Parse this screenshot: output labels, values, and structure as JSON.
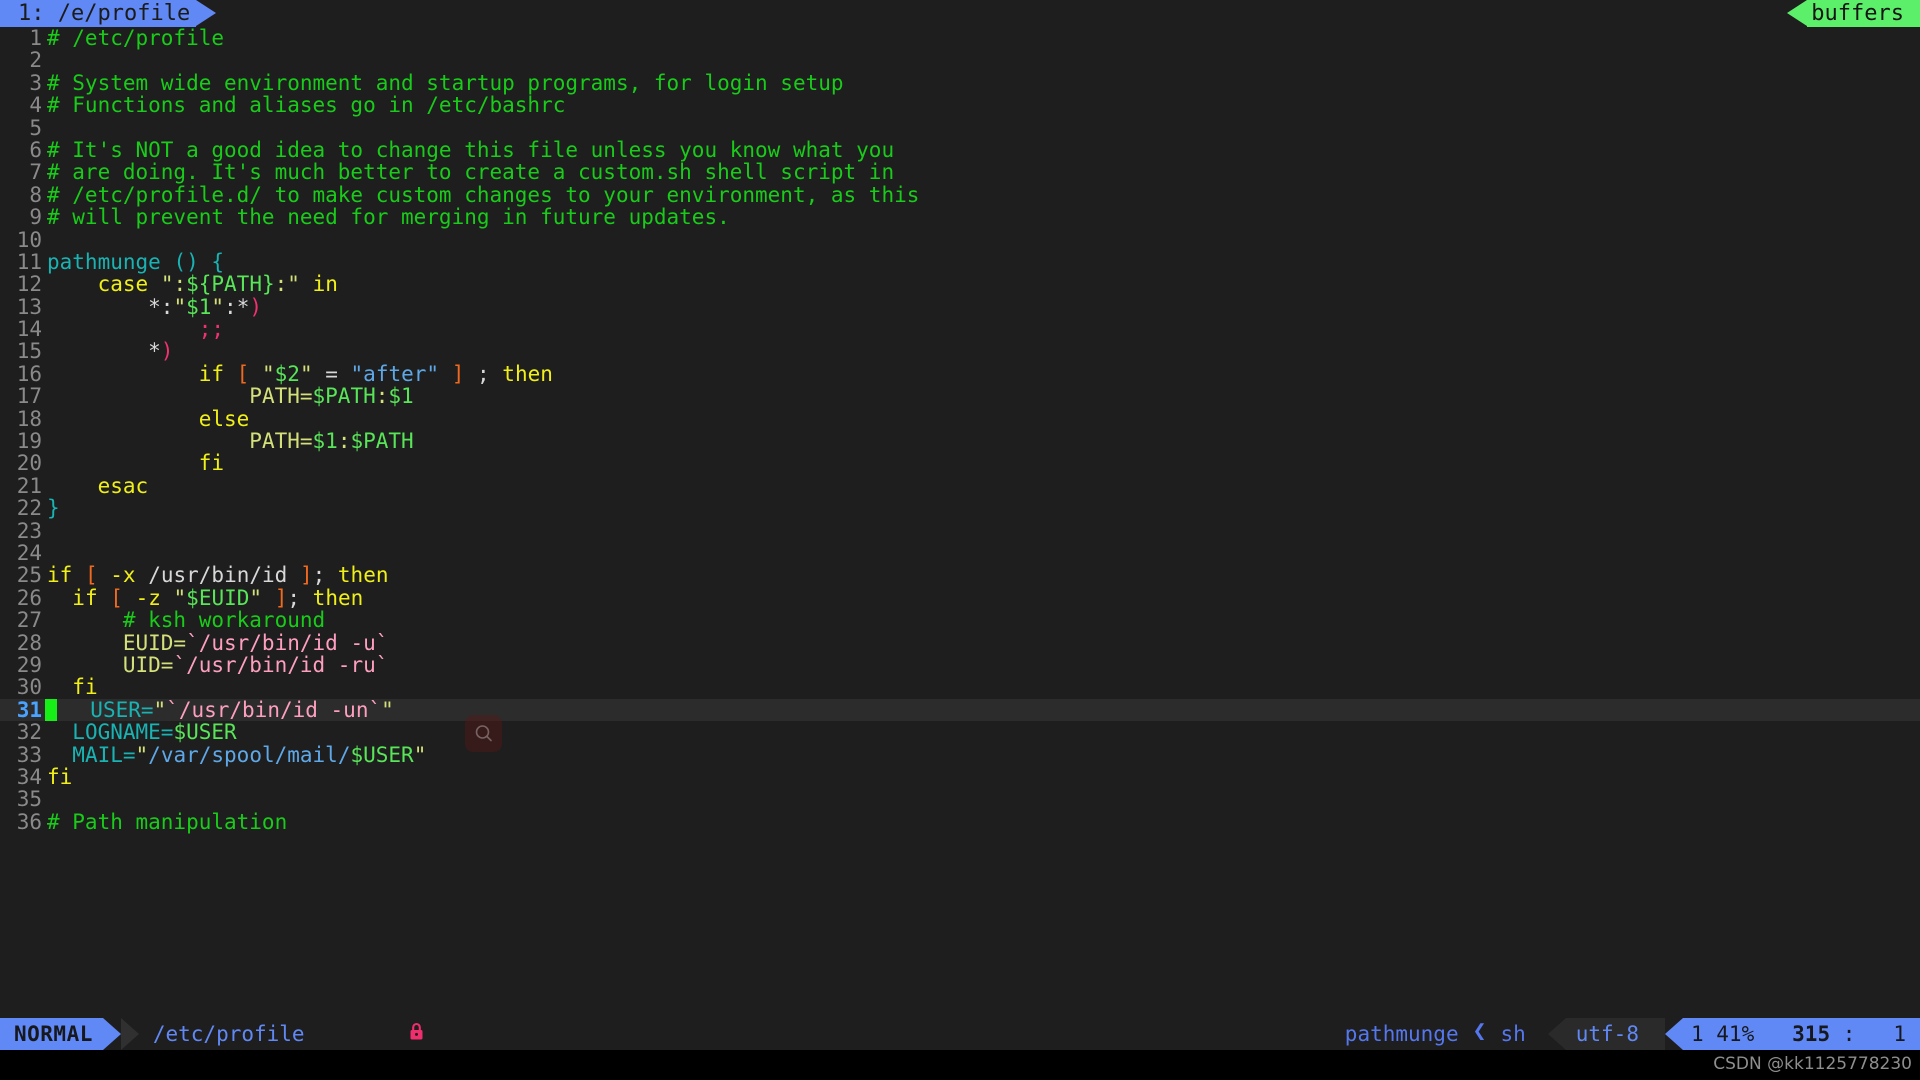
{
  "tabline": {
    "buffer_tab": "1: /e/profile",
    "buffers_label": "buffers",
    "tab_bg": "#6189f5",
    "buffers_bg": "#5cf06a"
  },
  "editor": {
    "filetype": "sh",
    "cursor_line": 31,
    "cursor_col": 1,
    "background": "#1e1e1e",
    "lines": [
      {
        "n": 1,
        "spans": [
          {
            "t": "# /etc/profile",
            "c": "c-comment"
          }
        ]
      },
      {
        "n": 2,
        "spans": []
      },
      {
        "n": 3,
        "spans": [
          {
            "t": "# System wide environment and startup programs, for login setup",
            "c": "c-comment"
          }
        ]
      },
      {
        "n": 4,
        "spans": [
          {
            "t": "# Functions and aliases go in /etc/bashrc",
            "c": "c-comment"
          }
        ]
      },
      {
        "n": 5,
        "spans": []
      },
      {
        "n": 6,
        "spans": [
          {
            "t": "# It's NOT a good idea to change this file unless you know what you",
            "c": "c-comment"
          }
        ]
      },
      {
        "n": 7,
        "spans": [
          {
            "t": "# are doing. It's much better to create a custom.sh shell script in",
            "c": "c-comment"
          }
        ]
      },
      {
        "n": 8,
        "spans": [
          {
            "t": "# /etc/profile.d/ to make custom changes to your environment, as this",
            "c": "c-comment"
          }
        ]
      },
      {
        "n": 9,
        "spans": [
          {
            "t": "# will prevent the need for merging in future updates.",
            "c": "c-comment"
          }
        ]
      },
      {
        "n": 10,
        "spans": []
      },
      {
        "n": 11,
        "spans": [
          {
            "t": "pathmunge",
            "c": "c-func"
          },
          {
            "t": " ",
            "c": "c-plain"
          },
          {
            "t": "()",
            "c": "c-paren"
          },
          {
            "t": " ",
            "c": "c-plain"
          },
          {
            "t": "{",
            "c": "c-brace"
          }
        ]
      },
      {
        "n": 12,
        "spans": [
          {
            "t": "    ",
            "c": "c-plain"
          },
          {
            "t": "case",
            "c": "c-keyword"
          },
          {
            "t": " ",
            "c": "c-plain"
          },
          {
            "t": "\":",
            "c": "c-string"
          },
          {
            "t": "${PATH}",
            "c": "c-var"
          },
          {
            "t": ":\"",
            "c": "c-string"
          },
          {
            "t": " ",
            "c": "c-plain"
          },
          {
            "t": "in",
            "c": "c-keyword"
          }
        ]
      },
      {
        "n": 13,
        "spans": [
          {
            "t": "        *:",
            "c": "c-plain"
          },
          {
            "t": "\"",
            "c": "c-string"
          },
          {
            "t": "$1",
            "c": "c-var"
          },
          {
            "t": "\"",
            "c": "c-string"
          },
          {
            "t": ":*",
            "c": "c-plain"
          },
          {
            "t": ")",
            "c": "c-punct"
          }
        ]
      },
      {
        "n": 14,
        "spans": [
          {
            "t": "            ",
            "c": "c-plain"
          },
          {
            "t": ";;",
            "c": "c-punct"
          }
        ]
      },
      {
        "n": 15,
        "spans": [
          {
            "t": "        *",
            "c": "c-plain"
          },
          {
            "t": ")",
            "c": "c-punct"
          }
        ]
      },
      {
        "n": 16,
        "spans": [
          {
            "t": "            ",
            "c": "c-plain"
          },
          {
            "t": "if",
            "c": "c-keyword"
          },
          {
            "t": " ",
            "c": "c-plain"
          },
          {
            "t": "[",
            "c": "c-bracket"
          },
          {
            "t": " ",
            "c": "c-plain"
          },
          {
            "t": "\"",
            "c": "c-string"
          },
          {
            "t": "$2",
            "c": "c-var"
          },
          {
            "t": "\"",
            "c": "c-string"
          },
          {
            "t": " = ",
            "c": "c-plain"
          },
          {
            "t": "\"after\"",
            "c": "c-str2"
          },
          {
            "t": " ",
            "c": "c-plain"
          },
          {
            "t": "]",
            "c": "c-bracket"
          },
          {
            "t": " ; ",
            "c": "c-plain"
          },
          {
            "t": "then",
            "c": "c-keyword"
          }
        ]
      },
      {
        "n": 17,
        "spans": [
          {
            "t": "                ",
            "c": "c-plain"
          },
          {
            "t": "PATH=",
            "c": "c-string"
          },
          {
            "t": "$PATH",
            "c": "c-var"
          },
          {
            "t": ":",
            "c": "c-string"
          },
          {
            "t": "$1",
            "c": "c-var"
          }
        ]
      },
      {
        "n": 18,
        "spans": [
          {
            "t": "            ",
            "c": "c-plain"
          },
          {
            "t": "else",
            "c": "c-keyword"
          }
        ]
      },
      {
        "n": 19,
        "spans": [
          {
            "t": "                ",
            "c": "c-plain"
          },
          {
            "t": "PATH=",
            "c": "c-string"
          },
          {
            "t": "$1",
            "c": "c-var"
          },
          {
            "t": ":",
            "c": "c-string"
          },
          {
            "t": "$PATH",
            "c": "c-var"
          }
        ]
      },
      {
        "n": 20,
        "spans": [
          {
            "t": "            ",
            "c": "c-plain"
          },
          {
            "t": "fi",
            "c": "c-keyword"
          }
        ]
      },
      {
        "n": 21,
        "spans": [
          {
            "t": "    ",
            "c": "c-plain"
          },
          {
            "t": "esac",
            "c": "c-keyword"
          }
        ]
      },
      {
        "n": 22,
        "spans": [
          {
            "t": "}",
            "c": "c-brace"
          }
        ]
      },
      {
        "n": 23,
        "spans": []
      },
      {
        "n": 24,
        "spans": []
      },
      {
        "n": 25,
        "spans": [
          {
            "t": "if",
            "c": "c-keyword"
          },
          {
            "t": " ",
            "c": "c-plain"
          },
          {
            "t": "[",
            "c": "c-bracket"
          },
          {
            "t": " ",
            "c": "c-plain"
          },
          {
            "t": "-x",
            "c": "c-keyword"
          },
          {
            "t": " /usr/bin/id ",
            "c": "c-plain"
          },
          {
            "t": "]",
            "c": "c-bracket"
          },
          {
            "t": ";",
            "c": "c-plain"
          },
          {
            "t": " ",
            "c": "c-plain"
          },
          {
            "t": "then",
            "c": "c-keyword"
          }
        ]
      },
      {
        "n": 26,
        "spans": [
          {
            "t": "  ",
            "c": "c-plain"
          },
          {
            "t": "if",
            "c": "c-keyword"
          },
          {
            "t": " ",
            "c": "c-plain"
          },
          {
            "t": "[",
            "c": "c-bracket"
          },
          {
            "t": " ",
            "c": "c-plain"
          },
          {
            "t": "-z",
            "c": "c-keyword"
          },
          {
            "t": " ",
            "c": "c-plain"
          },
          {
            "t": "\"",
            "c": "c-string"
          },
          {
            "t": "$EUID",
            "c": "c-var"
          },
          {
            "t": "\"",
            "c": "c-string"
          },
          {
            "t": " ",
            "c": "c-plain"
          },
          {
            "t": "]",
            "c": "c-bracket"
          },
          {
            "t": ";",
            "c": "c-plain"
          },
          {
            "t": " ",
            "c": "c-plain"
          },
          {
            "t": "then",
            "c": "c-keyword"
          }
        ]
      },
      {
        "n": 27,
        "spans": [
          {
            "t": "      ",
            "c": "c-plain"
          },
          {
            "t": "# ksh workaround",
            "c": "c-comment"
          }
        ]
      },
      {
        "n": 28,
        "spans": [
          {
            "t": "      ",
            "c": "c-plain"
          },
          {
            "t": "EUID=",
            "c": "c-string"
          },
          {
            "t": "`/usr/bin/id -u`",
            "c": "c-backtick"
          }
        ]
      },
      {
        "n": 29,
        "spans": [
          {
            "t": "      ",
            "c": "c-plain"
          },
          {
            "t": "UID=",
            "c": "c-string"
          },
          {
            "t": "`/usr/bin/id -ru`",
            "c": "c-backtick"
          }
        ]
      },
      {
        "n": 30,
        "spans": [
          {
            "t": "  ",
            "c": "c-plain"
          },
          {
            "t": "fi",
            "c": "c-keyword"
          }
        ]
      },
      {
        "n": 31,
        "spans": [
          {
            "t": "  ",
            "c": "c-plain"
          },
          {
            "t": "USER=",
            "c": "c-ident"
          },
          {
            "t": "\"",
            "c": "c-string"
          },
          {
            "t": "`/usr/bin/id -un`",
            "c": "c-backtick"
          },
          {
            "t": "\"",
            "c": "c-string"
          }
        ],
        "cursor": true
      },
      {
        "n": 32,
        "spans": [
          {
            "t": "  ",
            "c": "c-plain"
          },
          {
            "t": "LOGNAME=",
            "c": "c-ident"
          },
          {
            "t": "$USER",
            "c": "c-var"
          }
        ]
      },
      {
        "n": 33,
        "spans": [
          {
            "t": "  ",
            "c": "c-plain"
          },
          {
            "t": "MAIL=",
            "c": "c-ident"
          },
          {
            "t": "\"",
            "c": "c-string"
          },
          {
            "t": "/var/spool/mail/",
            "c": "c-str2"
          },
          {
            "t": "$USER",
            "c": "c-var"
          },
          {
            "t": "\"",
            "c": "c-string"
          }
        ]
      },
      {
        "n": 34,
        "spans": [
          {
            "t": "fi",
            "c": "c-keyword"
          }
        ]
      },
      {
        "n": 35,
        "spans": []
      },
      {
        "n": 36,
        "spans": [
          {
            "t": "# Path manipulation",
            "c": "c-comment"
          }
        ]
      }
    ]
  },
  "statusline": {
    "mode": "NORMAL",
    "file_path": "/etc/profile",
    "lock_icon": "lock-icon",
    "lock_glyph": "🔒",
    "context": "pathmunge",
    "context_separator": "❮",
    "filetype": "sh",
    "encoding": "utf-8",
    "buffer_number": "1",
    "percent": "41%",
    "line": "315",
    "col_separator": ":",
    "column": "1",
    "mode_bg": "#6189f5",
    "accent": "#6189f5",
    "lock_color": "#ef2e6e"
  },
  "mouse": {
    "cursor_icon": "search-magnifier-icon"
  },
  "watermark": {
    "text": "CSDN @kk1125778230"
  }
}
